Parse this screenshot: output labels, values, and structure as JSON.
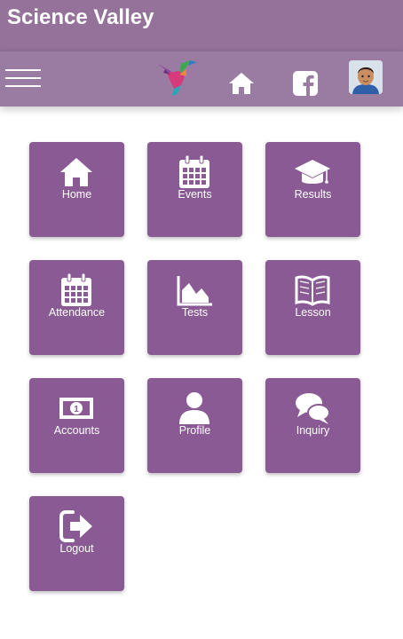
{
  "app": {
    "title": "Science Valley"
  },
  "toolbar": {
    "menu_icon": "hamburger-icon",
    "logo_icon": "hummingbird-logo",
    "home_icon": "home-icon",
    "facebook_icon": "facebook-icon",
    "avatar": "user-avatar"
  },
  "tiles": [
    {
      "label": "Home",
      "icon": "home-icon"
    },
    {
      "label": "Events",
      "icon": "calendar-icon"
    },
    {
      "label": "Results",
      "icon": "graduation-cap-icon"
    },
    {
      "label": "Attendance",
      "icon": "calendar-icon"
    },
    {
      "label": "Tests",
      "icon": "area-chart-icon"
    },
    {
      "label": "Lesson",
      "icon": "book-icon"
    },
    {
      "label": "Accounts",
      "icon": "money-icon"
    },
    {
      "label": "Profile",
      "icon": "user-icon"
    },
    {
      "label": "Inquiry",
      "icon": "chat-icon"
    },
    {
      "label": "Logout",
      "icon": "sign-out-icon"
    }
  ],
  "colors": {
    "header": "#94729a",
    "toolbar": "#9a7ca2",
    "tile": "#8a5a94"
  }
}
